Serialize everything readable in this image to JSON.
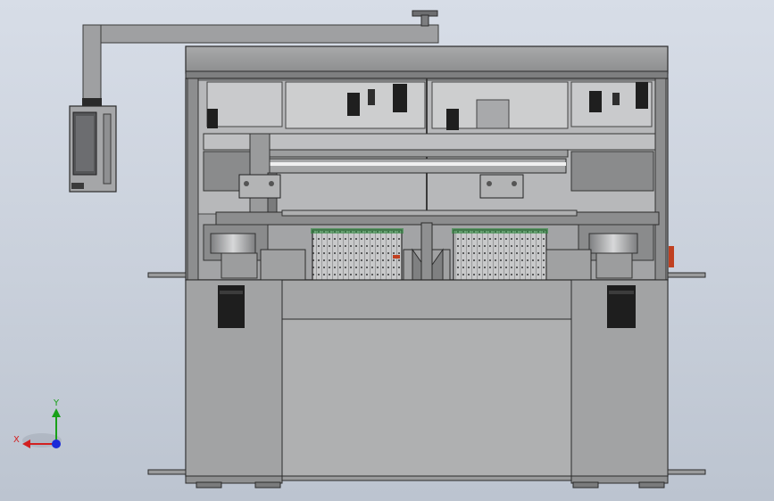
{
  "view": {
    "background_top": "#d7dde7",
    "background_bottom": "#bcc4d0"
  },
  "triad": {
    "x_label": "X",
    "y_label": "Y",
    "x_color": "#d22020",
    "y_color": "#18a018",
    "z_color": "#1a2ad8"
  },
  "model": {
    "frame_color": "#8e8f90",
    "panel_color": "#9a9b9c",
    "dark_color": "#1e1e1e",
    "accent_color": "#c04020",
    "green_accent": "#2c8a3c"
  }
}
